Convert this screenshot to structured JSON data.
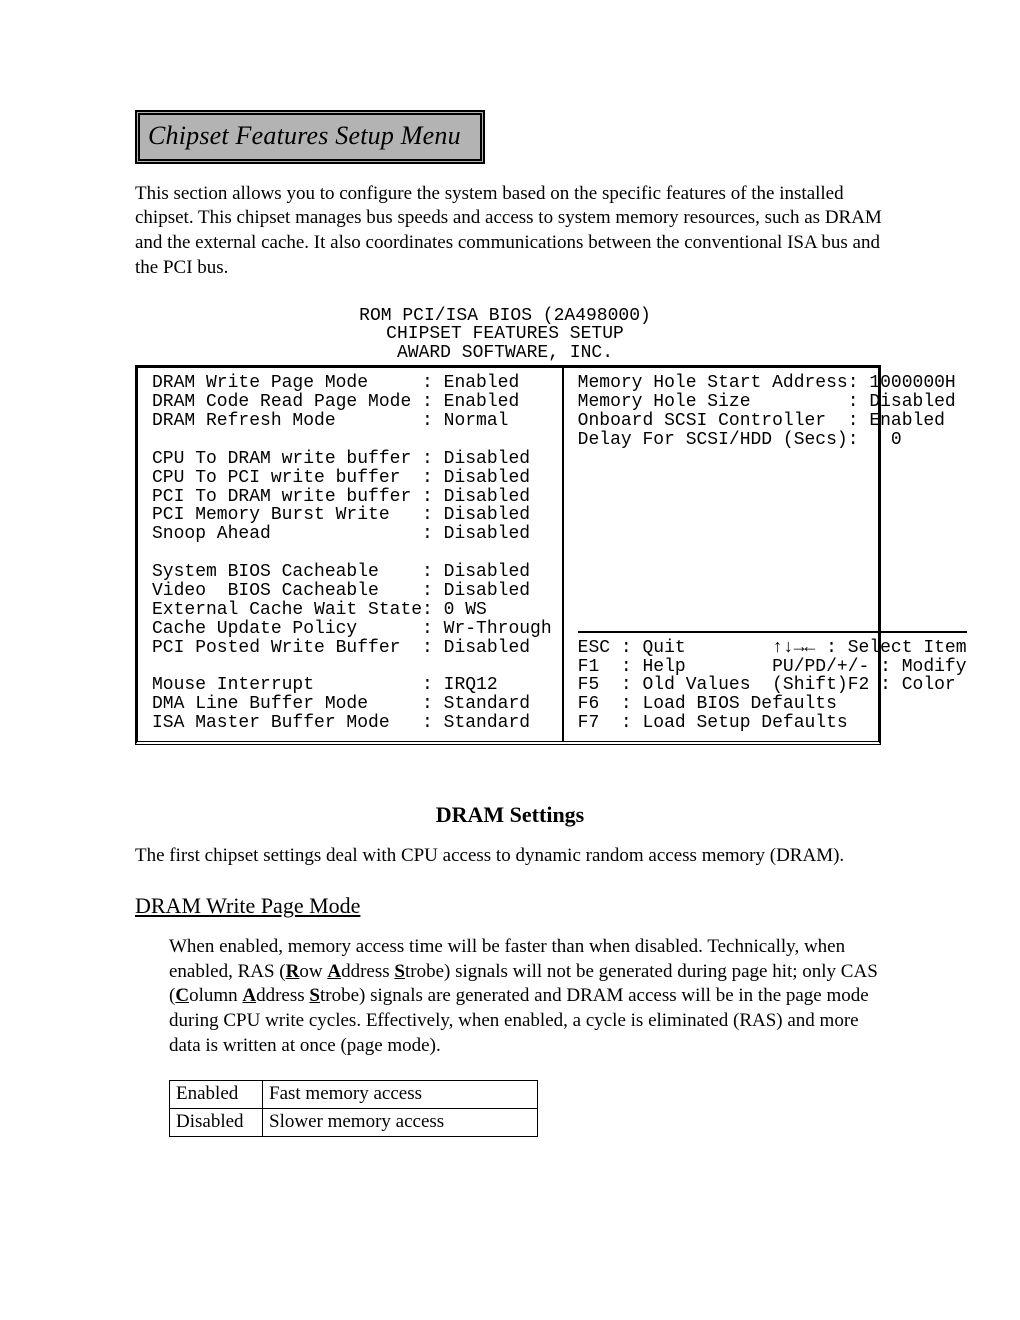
{
  "title_bar": "Chipset Features Setup Menu",
  "intro": "This section allows you to configure the system based on the specific features of the installed chipset.  This chipset manages bus speeds and access to system memory resources, such as DRAM and the external cache.  It also coordinates communications between the conventional ISA bus and the PCI bus.",
  "bios_header_lines": [
    "ROM PCI/ISA BIOS (2A498000)",
    "CHIPSET FEATURES SETUP",
    "AWARD SOFTWARE, INC."
  ],
  "bios_left": [
    "DRAM Write Page Mode     : Enabled",
    "DRAM Code Read Page Mode : Enabled",
    "DRAM Refresh Mode        : Normal",
    "",
    "CPU To DRAM write buffer : Disabled",
    "CPU To PCI write buffer  : Disabled",
    "PCI To DRAM write buffer : Disabled",
    "PCI Memory Burst Write   : Disabled",
    "Snoop Ahead              : Disabled",
    "",
    "System BIOS Cacheable    : Disabled",
    "Video  BIOS Cacheable    : Disabled",
    "External Cache Wait State: 0 WS",
    "Cache Update Policy      : Wr-Through",
    "PCI Posted Write Buffer  : Disabled",
    "",
    "Mouse Interrupt          : IRQ12",
    "DMA Line Buffer Mode     : Standard",
    "ISA Master Buffer Mode   : Standard"
  ],
  "bios_right_top": [
    "Memory Hole Start Address: 1000000H",
    "Memory Hole Size         : Disabled",
    "Onboard SCSI Controller  : Enabled",
    "Delay For SCSI/HDD (Secs):   0"
  ],
  "bios_keys": [
    "ESC : Quit        ↑↓→← : Select Item",
    "F1  : Help        PU/PD/+/- : Modify",
    "F5  : Old Values  (Shift)F2 : Color",
    "F6  : Load BIOS Defaults",
    "F7  : Load Setup Defaults"
  ],
  "dram_section_title": "DRAM Settings",
  "dram_intro": "The first chipset settings deal with CPU access to dynamic random access memory (DRAM).",
  "sub_heading": "DRAM Write Page Mode",
  "detail_p1a": "When enabled, memory access time will be faster than when disabled.  Technically, when enabled, RAS (",
  "detail_R": "R",
  "detail_p1b": "ow ",
  "detail_A1": "A",
  "detail_p1c": "ddress ",
  "detail_S1": "S",
  "detail_p1d": "trobe) signals will not be generated during page hit; only CAS (",
  "detail_C": "C",
  "detail_p1e": "olumn ",
  "detail_A2": "A",
  "detail_p1f": "ddress ",
  "detail_S2": "S",
  "detail_p1g": "trobe) signals are generated and DRAM access will be in the page mode during CPU write cycles.  Effectively, when enabled, a cycle is eliminated (RAS) and more data is written at once (page mode).",
  "options": [
    {
      "k": "Enabled",
      "v": "Fast memory access"
    },
    {
      "k": "Disabled",
      "v": "Slower memory access"
    }
  ]
}
